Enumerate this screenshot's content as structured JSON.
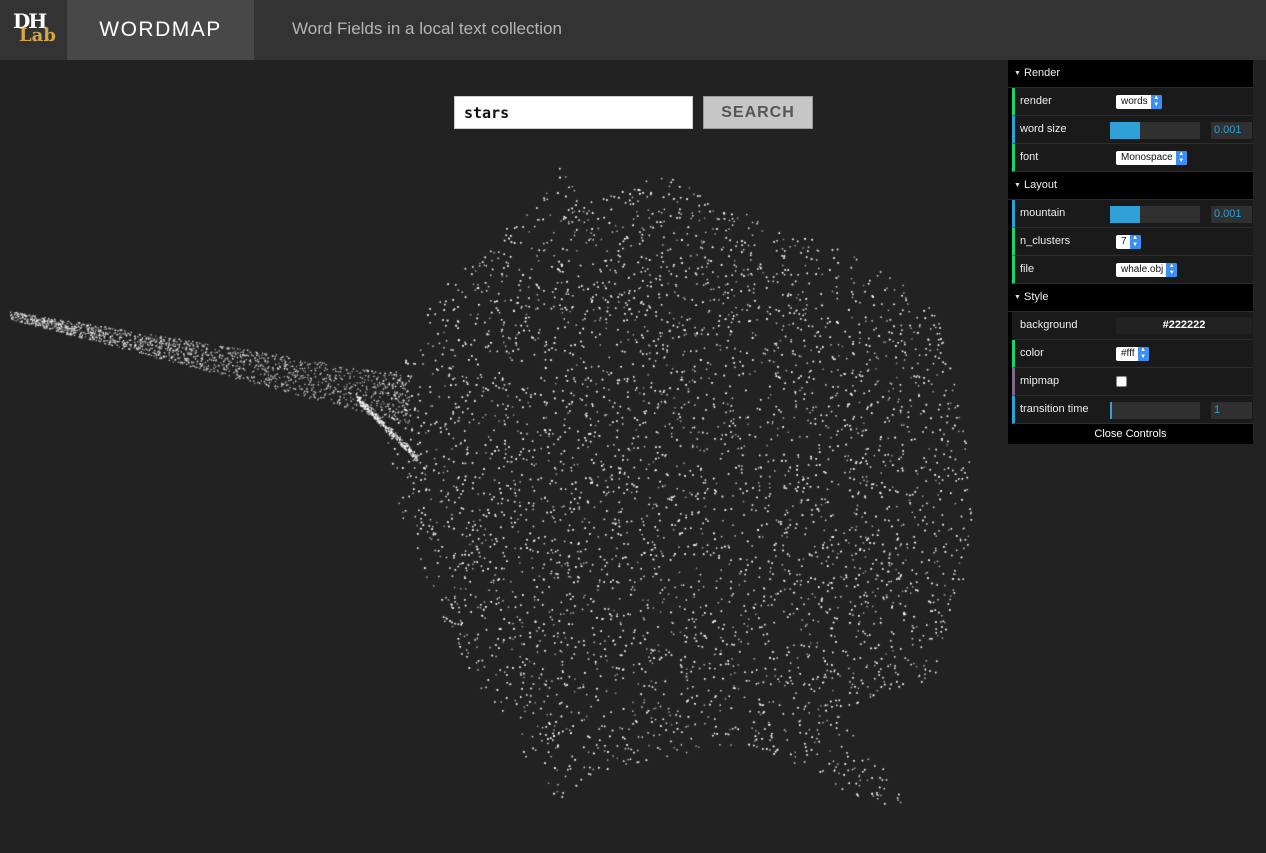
{
  "header": {
    "logo_top": "DH",
    "logo_bottom": "Lab",
    "brand": "WORDMAP",
    "subtitle": "Word Fields in a local text collection"
  },
  "search": {
    "value": "stars",
    "button_label": "SEARCH"
  },
  "controls": {
    "folders": [
      {
        "title": "Render"
      },
      {
        "title": "Layout"
      },
      {
        "title": "Style"
      }
    ],
    "render": {
      "render_label": "render",
      "render_value": "words",
      "word_size_label": "word size",
      "word_size_value": "0.001",
      "word_size_fraction": 0.33,
      "font_label": "font",
      "font_value": "Monospace"
    },
    "layout": {
      "mountain_label": "mountain",
      "mountain_value": "0.001",
      "mountain_fraction": 0.33,
      "n_clusters_label": "n_clusters",
      "n_clusters_value": "7",
      "file_label": "file",
      "file_value": "whale.obj"
    },
    "style": {
      "background_label": "background",
      "background_value": "#222222",
      "color_label": "color",
      "color_value": "#fff",
      "mipmap_label": "mipmap",
      "mipmap_checked": false,
      "transition_label": "transition time",
      "transition_value": "1",
      "transition_fraction": 0.0
    },
    "close_label": "Close Controls"
  },
  "visualization": {
    "background_color": "#222222",
    "point_color": "#ffffff"
  },
  "colors": {
    "accent_blue": "#2fa1d6",
    "accent_green": "#1ed36f",
    "accent_purple": "#806787",
    "topbar": "#333333",
    "brand_bg": "#484848",
    "logo_gold": "#d4a64a"
  }
}
